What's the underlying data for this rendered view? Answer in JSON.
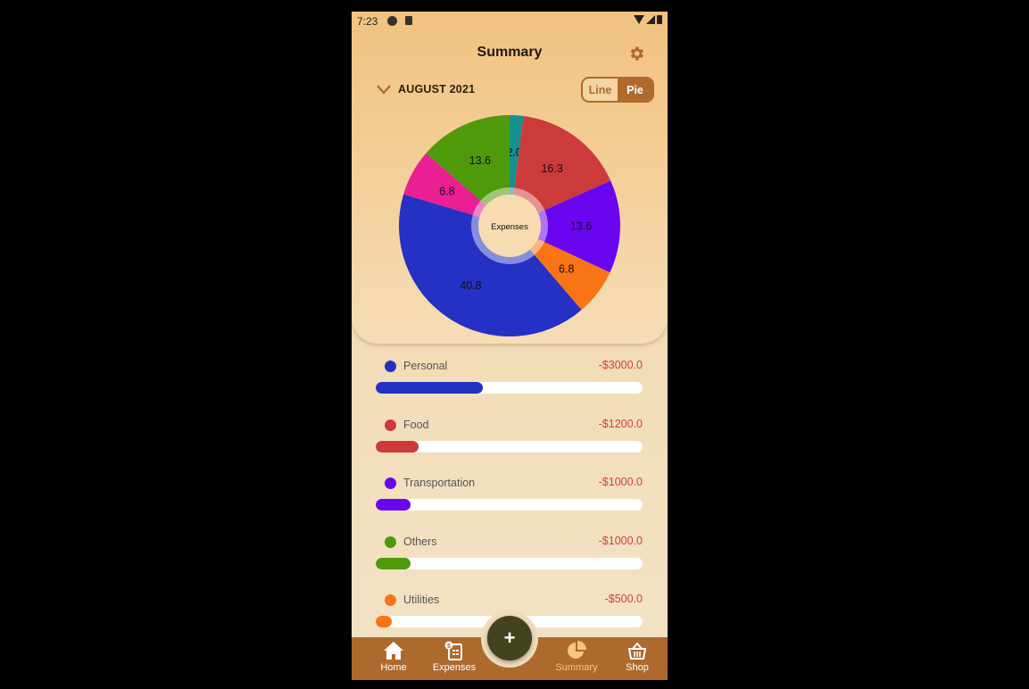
{
  "status_bar": {
    "time": "7:23"
  },
  "header": {
    "title": "Summary"
  },
  "period": {
    "label": "AUGUST 2021"
  },
  "view_toggle": {
    "line_label": "Line",
    "pie_label": "Pie",
    "selected": "Pie"
  },
  "chart_data": {
    "type": "pie",
    "center_label": "Expenses",
    "slices": [
      {
        "label": "2.0",
        "value": 2.0,
        "color": "#14908e"
      },
      {
        "label": "16.3",
        "value": 16.3,
        "color": "#cc3b3b"
      },
      {
        "label": "13.6",
        "value": 13.6,
        "color": "#6a06ef"
      },
      {
        "label": "6.8",
        "value": 6.8,
        "color": "#f97414"
      },
      {
        "label": "40.8",
        "value": 40.8,
        "color": "#2530c4"
      },
      {
        "label": "6.8",
        "value": 6.8,
        "color": "#e91f93"
      },
      {
        "label": "13.6",
        "value": 13.6,
        "color": "#4f9a0b"
      }
    ]
  },
  "categories": [
    {
      "name": "Personal",
      "amount": "-$3000.0",
      "color": "#2530c4",
      "fraction": 0.4
    },
    {
      "name": "Food",
      "amount": "-$1200.0",
      "color": "#cc3b3b",
      "fraction": 0.16
    },
    {
      "name": "Transportation",
      "amount": "-$1000.0",
      "color": "#6a06ef",
      "fraction": 0.13
    },
    {
      "name": "Others",
      "amount": "-$1000.0",
      "color": "#4f9a0b",
      "fraction": 0.13
    },
    {
      "name": "Utilities",
      "amount": "-$500.0",
      "color": "#f97414",
      "fraction": 0.06
    }
  ],
  "bottom_nav": {
    "home": "Home",
    "expenses": "Expenses",
    "fab": "+",
    "summary": "Summary",
    "shop": "Shop"
  },
  "colors": {
    "accent": "#ad6a2c",
    "fab": "#43431f",
    "negative": "#d33e3e"
  }
}
